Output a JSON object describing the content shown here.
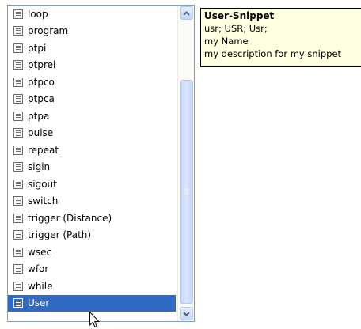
{
  "list": {
    "items": [
      {
        "label": "loop",
        "selected": false
      },
      {
        "label": "program",
        "selected": false
      },
      {
        "label": "ptpi",
        "selected": false
      },
      {
        "label": "ptprel",
        "selected": false
      },
      {
        "label": "ptpco",
        "selected": false
      },
      {
        "label": "ptpca",
        "selected": false
      },
      {
        "label": "ptpa",
        "selected": false
      },
      {
        "label": "pulse",
        "selected": false
      },
      {
        "label": "repeat",
        "selected": false
      },
      {
        "label": "sigin",
        "selected": false
      },
      {
        "label": "sigout",
        "selected": false
      },
      {
        "label": "switch",
        "selected": false
      },
      {
        "label": "trigger (Distance)",
        "selected": false
      },
      {
        "label": "trigger (Path)",
        "selected": false
      },
      {
        "label": "wsec",
        "selected": false
      },
      {
        "label": "wfor",
        "selected": false
      },
      {
        "label": "while",
        "selected": false
      },
      {
        "label": "User",
        "selected": true
      }
    ],
    "item_icon": "snippet-icon",
    "selection_color": "#316ac5"
  },
  "scrollbar": {
    "up_icon": "chevron-up-icon",
    "down_icon": "chevron-down-icon",
    "position_fraction": 1.0
  },
  "tooltip": {
    "title": "User-Snippet",
    "line1": "usr; USR; Usr;",
    "line2": "my Name",
    "line3": "my description for my snippet",
    "background": "#ffffe1"
  }
}
